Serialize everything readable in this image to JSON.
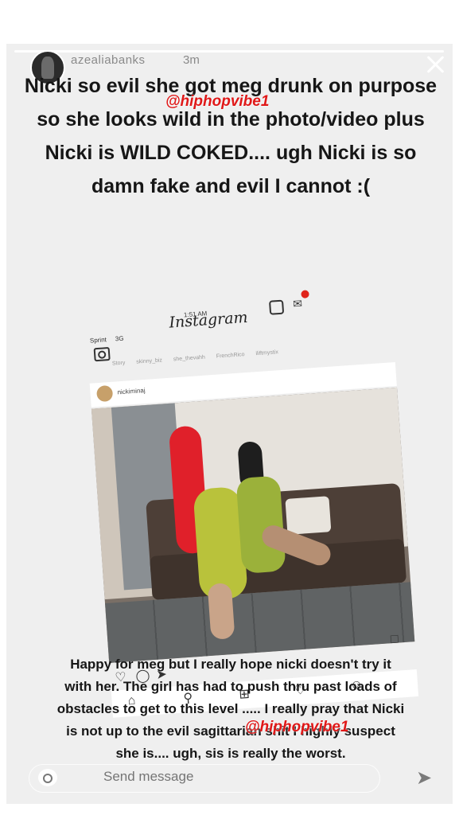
{
  "story": {
    "username": "azealiabanks",
    "time_ago": "3m",
    "caption_top": "Nicki so evil she got meg drunk on purpose so she looks wild in the photo/video plus Nicki is WILD COKED.... ugh Nicki is so damn fake and evil I cannot :(",
    "caption_bottom": "Happy for meg but I really hope nicki doesn't try it with her. The girl has had to push thru past loads of obstacles to get to this level ..... I really pray that Nicki is not up to the evil sagittarian shit I highly suspect she is.... ugh, sis is really the worst.",
    "watermark": "@hiphopvibe1"
  },
  "embedded_post": {
    "carrier": "Sprint",
    "network": "3G",
    "clock": "1:51 AM",
    "app_logo": "Instagram",
    "post_user": "nickiminaj",
    "stories": [
      "Story",
      "skinny_biz",
      "she_thevahh",
      "FrenchRico",
      "iliftmystix"
    ]
  },
  "reply": {
    "placeholder": "Send message"
  },
  "icons": {
    "close": "close-icon",
    "camera": "camera-icon",
    "send": "send-icon"
  }
}
